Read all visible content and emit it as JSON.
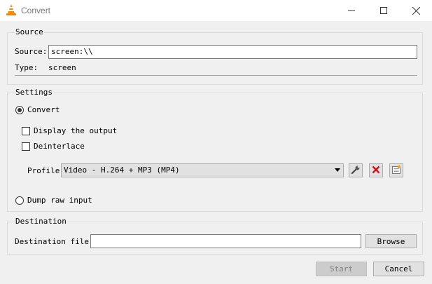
{
  "window": {
    "title": "Convert",
    "icon": "vlc-cone-icon"
  },
  "source": {
    "group_title": "Source",
    "source_label": "Source:",
    "source_value": "screen:\\\\",
    "type_label": "Type:",
    "type_value": "screen"
  },
  "settings": {
    "group_title": "Settings",
    "convert_label": "Convert",
    "convert_selected": true,
    "display_output_label": "Display the output",
    "display_output_checked": false,
    "deinterlace_label": "Deinterlace",
    "deinterlace_checked": false,
    "profile_label": "Profile",
    "profile_value": "Video - H.264 + MP3 (MP4)",
    "profile_tool_icons": [
      "wrench-icon",
      "delete-icon",
      "new-profile-icon"
    ],
    "dump_raw_label": "Dump raw input",
    "dump_raw_selected": false
  },
  "destination": {
    "group_title": "Destination",
    "file_label": "Destination file:",
    "file_value": "",
    "browse_label": "Browse"
  },
  "actions": {
    "start_label": "Start",
    "start_enabled": false,
    "cancel_label": "Cancel"
  },
  "colors": {
    "delete_red": "#d0101a",
    "vlc_orange": "#f18a00"
  }
}
